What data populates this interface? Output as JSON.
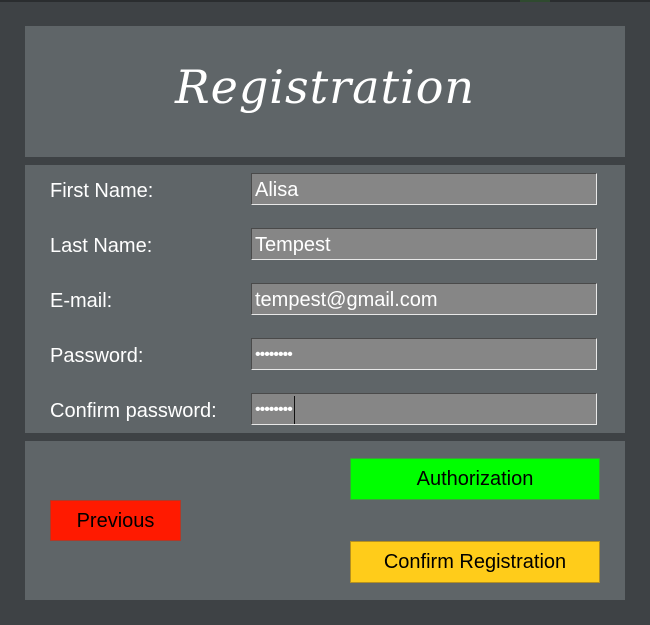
{
  "header": {
    "title": "Registration"
  },
  "form": {
    "first_name": {
      "label": "First Name:",
      "value": "Alisa"
    },
    "last_name": {
      "label": "Last Name:",
      "value": "Tempest"
    },
    "email": {
      "label": "E-mail:",
      "value": "tempest@gmail.com"
    },
    "password": {
      "label": "Password:",
      "value": "••••••••"
    },
    "confirm_password": {
      "label": "Confirm password:",
      "value": "••••••••"
    }
  },
  "buttons": {
    "authorization": "Authorization",
    "previous": "Previous",
    "confirm_registration": "Confirm Registration"
  },
  "colors": {
    "background": "#3e4245",
    "panel": "#5f6568",
    "field": "#868686",
    "authorization_button": "#00ff00",
    "previous_button": "#ff1a00",
    "confirm_button": "#ffcc1a"
  }
}
